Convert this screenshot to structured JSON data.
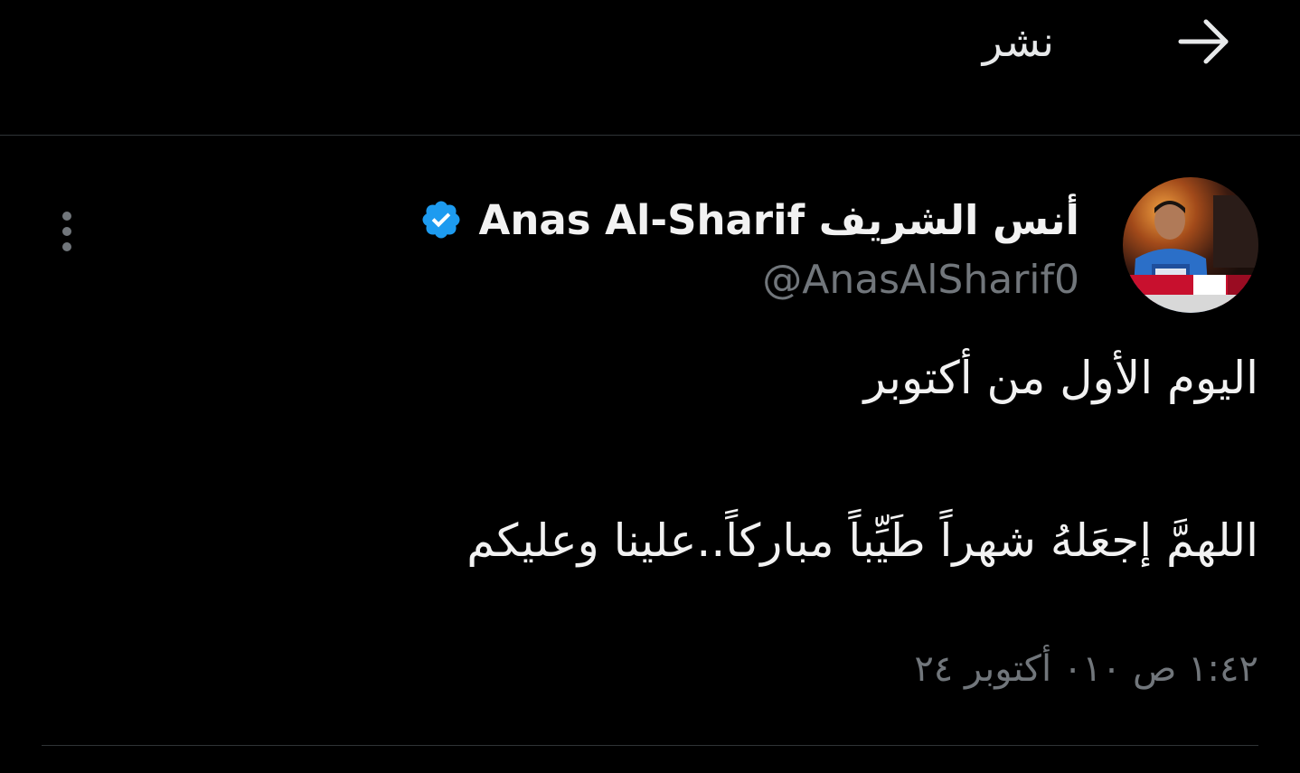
{
  "header": {
    "title": "نشر",
    "back_icon": "arrow-right-icon"
  },
  "tweet": {
    "author": {
      "display_name": "أنس الشريف Anas Al-Sharif",
      "handle": "@AnasAlSharif0",
      "verified": true,
      "verified_color": "#1d9bf0"
    },
    "text_lines": [
      "اليوم الأول من أكتوبر",
      "اللهمَّ إجعَلهُ شهراً طَيِّباً مباركاً..علينا وعليكم"
    ],
    "timestamp": "١:٤٢ ص ٠١٠ أكتوبر ٢٤"
  },
  "colors": {
    "background": "#000000",
    "text_primary": "#e7e9ea",
    "text_secondary": "#71767b",
    "border": "#2f3336"
  }
}
